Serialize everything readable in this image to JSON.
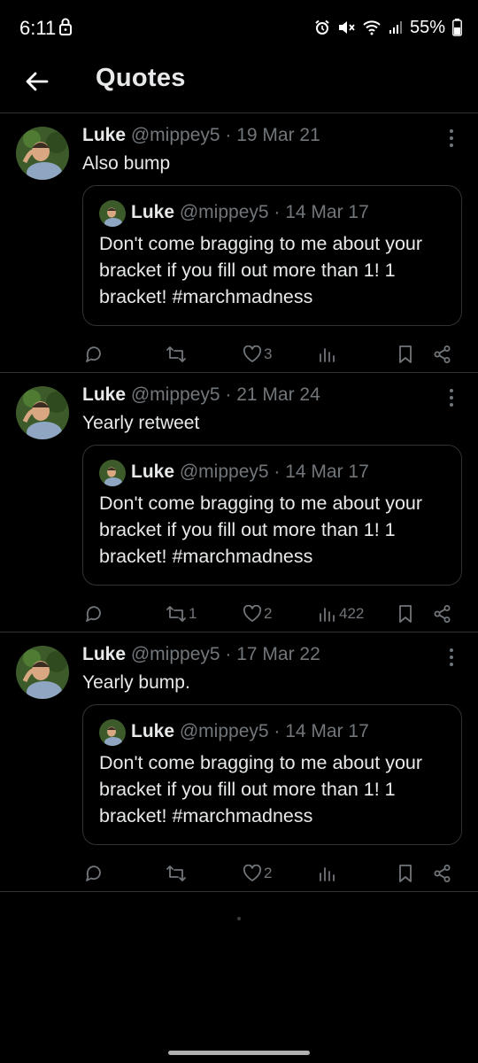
{
  "status_bar": {
    "time": "6:11",
    "battery": "55%"
  },
  "header": {
    "title": "Quotes"
  },
  "tweets": [
    {
      "name": "Luke",
      "meta": "@mippey5 · 19 Mar 21",
      "text": "Also bump",
      "quote": {
        "name": "Luke",
        "meta": "@mippey5 · 14 Mar 17",
        "text": "Don't come bragging to me about your bracket if you fill out more than 1! 1 bracket! #marchmadness"
      },
      "stats": {
        "reply": "",
        "retweet": "",
        "like": "3",
        "views": ""
      }
    },
    {
      "name": "Luke",
      "meta": "@mippey5 · 21 Mar 24",
      "text": "Yearly retweet",
      "quote": {
        "name": "Luke",
        "meta": "@mippey5 · 14 Mar 17",
        "text": "Don't come bragging to me about your bracket if you fill out more than 1! 1 bracket! #marchmadness"
      },
      "stats": {
        "reply": "",
        "retweet": "1",
        "like": "2",
        "views": "422"
      }
    },
    {
      "name": "Luke",
      "meta": "@mippey5 · 17 Mar 22",
      "text": "Yearly bump.",
      "quote": {
        "name": "Luke",
        "meta": "@mippey5 · 14 Mar 17",
        "text": "Don't come bragging to me about your bracket if you fill out more than 1! 1 bracket! #marchmadness"
      },
      "stats": {
        "reply": "",
        "retweet": "",
        "like": "2",
        "views": ""
      }
    }
  ],
  "icons": {
    "back": "arrow-left-icon",
    "more": "more-vertical-icon",
    "reply": "reply-icon",
    "retweet": "retweet-icon",
    "like": "heart-icon",
    "views": "views-icon",
    "bookmark": "bookmark-icon",
    "share": "share-icon"
  },
  "colors": {
    "background": "#000000",
    "text": "#e7e9ea",
    "muted": "#71767b",
    "border": "#2f3336"
  }
}
